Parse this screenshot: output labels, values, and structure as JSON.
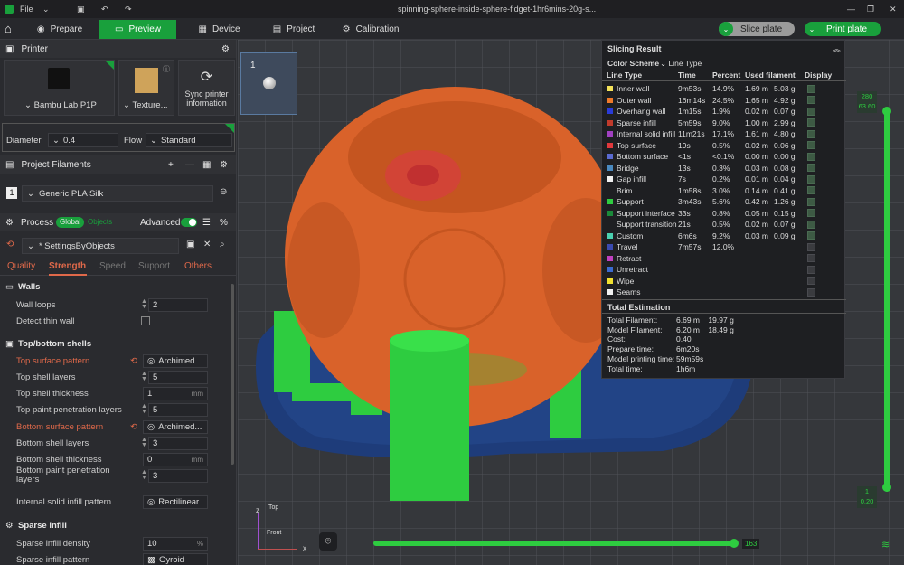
{
  "titlebar": {
    "file_label": "File",
    "title": "spinning-sphere-inside-sphere-fidget-1hr6mins-20g-s..."
  },
  "tabs": [
    {
      "label": "Prepare"
    },
    {
      "label": "Preview"
    },
    {
      "label": "Device"
    },
    {
      "label": "Project"
    },
    {
      "label": "Calibration"
    }
  ],
  "actions": {
    "slice": "Slice plate",
    "print": "Print plate"
  },
  "printer": {
    "header": "Printer",
    "name": "Bambu Lab P1P",
    "plate": "Texture...",
    "sync": "Sync printer information",
    "diameter_label": "Diameter",
    "diameter": "0.4",
    "flow_label": "Flow",
    "flow": "Standard"
  },
  "filaments": {
    "header": "Project Filaments",
    "index": "1",
    "name": "Generic PLA Silk"
  },
  "process": {
    "header": "Process",
    "global": "Global",
    "objects": "Objects",
    "advanced": "Advanced",
    "preset": "* SettingsByObjects"
  },
  "subtabs": [
    "Quality",
    "Strength",
    "Speed",
    "Support",
    "Others"
  ],
  "walls": {
    "header": "Walls",
    "loops_label": "Wall loops",
    "loops": "2",
    "thin_label": "Detect thin wall"
  },
  "shells": {
    "header": "Top/bottom shells",
    "rows": [
      {
        "label": "Top surface pattern",
        "value": "Archimed...",
        "mod": true
      },
      {
        "label": "Top shell layers",
        "value": "5"
      },
      {
        "label": "Top shell thickness",
        "value": "1",
        "unit": "mm"
      },
      {
        "label": "Top paint penetration layers",
        "value": "5"
      },
      {
        "label": "Bottom surface pattern",
        "value": "Archimed...",
        "mod": true
      },
      {
        "label": "Bottom shell layers",
        "value": "3"
      },
      {
        "label": "Bottom shell thickness",
        "value": "0",
        "unit": "mm"
      },
      {
        "label": "Bottom paint penetration layers",
        "value": "3"
      },
      {
        "label": "Internal solid infill pattern",
        "value": "Rectilinear"
      }
    ]
  },
  "sparse": {
    "header": "Sparse infill",
    "density_label": "Sparse infill density",
    "density": "10",
    "unit": "%",
    "pattern_label": "Sparse infill pattern",
    "pattern": "Gyroid"
  },
  "plate": {
    "number": "1"
  },
  "axes": {
    "top": "Top",
    "front": "Front",
    "x": "x",
    "z": "z"
  },
  "layer": {
    "top": "280",
    "top2": "63.60",
    "bottom": "1",
    "bottom2": "0.20",
    "hslider": "163"
  },
  "slicing": {
    "title": "Slicing Result",
    "scheme_label": "Color Scheme",
    "scheme": "Line Type",
    "headers": [
      "Line Type",
      "Time",
      "Percent",
      "Used filament",
      "Display"
    ],
    "rows": [
      {
        "name": "Inner wall",
        "color": "#f4e25a",
        "time": "9m53s",
        "pct": "14.9%",
        "len": "1.69 m",
        "g": "5.03 g",
        "on": true
      },
      {
        "name": "Outer wall",
        "color": "#f07a2a",
        "time": "16m14s",
        "pct": "24.5%",
        "len": "1.65 m",
        "g": "4.92 g",
        "on": true
      },
      {
        "name": "Overhang wall",
        "color": "#2a3bd8",
        "time": "1m15s",
        "pct": "1.9%",
        "len": "0.02 m",
        "g": "0.07 g",
        "on": true
      },
      {
        "name": "Sparse infill",
        "color": "#c03a2b",
        "time": "5m59s",
        "pct": "9.0%",
        "len": "1.00 m",
        "g": "2.99 g",
        "on": true
      },
      {
        "name": "Internal solid infill",
        "color": "#a040c0",
        "time": "11m21s",
        "pct": "17.1%",
        "len": "1.61 m",
        "g": "4.80 g",
        "on": true
      },
      {
        "name": "Top surface",
        "color": "#e0383c",
        "time": "19s",
        "pct": "0.5%",
        "len": "0.02 m",
        "g": "0.06 g",
        "on": true
      },
      {
        "name": "Bottom surface",
        "color": "#5a6ad0",
        "time": "<1s",
        "pct": "<0.1%",
        "len": "0.00 m",
        "g": "0.00 g",
        "on": true
      },
      {
        "name": "Bridge",
        "color": "#4a8ac0",
        "time": "13s",
        "pct": "0.3%",
        "len": "0.03 m",
        "g": "0.08 g",
        "on": true
      },
      {
        "name": "Gap infill",
        "color": "#f0f0f0",
        "time": "7s",
        "pct": "0.2%",
        "len": "0.01 m",
        "g": "0.04 g",
        "on": true
      },
      {
        "name": "Brim",
        "color": "#1e1f22",
        "time": "1m58s",
        "pct": "3.0%",
        "len": "0.14 m",
        "g": "0.41 g",
        "on": true
      },
      {
        "name": "Support",
        "color": "#2ecc40",
        "time": "3m43s",
        "pct": "5.6%",
        "len": "0.42 m",
        "g": "1.26 g",
        "on": true
      },
      {
        "name": "Support interface",
        "color": "#1a8a3a",
        "time": "33s",
        "pct": "0.8%",
        "len": "0.05 m",
        "g": "0.15 g",
        "on": true
      },
      {
        "name": "Support transition",
        "color": "#1e1f22",
        "time": "21s",
        "pct": "0.5%",
        "len": "0.02 m",
        "g": "0.07 g",
        "on": true
      },
      {
        "name": "Custom",
        "color": "#4ad0b0",
        "time": "6m6s",
        "pct": "9.2%",
        "len": "0.03 m",
        "g": "0.09 g",
        "on": true
      },
      {
        "name": "Travel",
        "color": "#3a4ab0",
        "time": "7m57s",
        "pct": "12.0%",
        "len": "",
        "g": "",
        "on": false
      },
      {
        "name": "Retract",
        "color": "#c040c0",
        "time": "",
        "pct": "",
        "len": "",
        "g": "",
        "on": false
      },
      {
        "name": "Unretract",
        "color": "#3a6ad0",
        "time": "",
        "pct": "",
        "len": "",
        "g": "",
        "on": false
      },
      {
        "name": "Wipe",
        "color": "#f0e030",
        "time": "",
        "pct": "",
        "len": "",
        "g": "",
        "on": false
      },
      {
        "name": "Seams",
        "color": "#f0f0f0",
        "time": "",
        "pct": "",
        "len": "",
        "g": "",
        "on": false
      }
    ],
    "est_title": "Total Estimation",
    "est": [
      {
        "k": "Total Filament:",
        "v": "6.69 m    19.97 g"
      },
      {
        "k": "Model Filament:",
        "v": "6.20 m    18.49 g"
      },
      {
        "k": "Cost:",
        "v": "0.40"
      },
      {
        "k": "Prepare time:",
        "v": "6m20s"
      },
      {
        "k": "Model printing time:",
        "v": "59m59s"
      },
      {
        "k": "Total time:",
        "v": "1h6m"
      }
    ]
  }
}
